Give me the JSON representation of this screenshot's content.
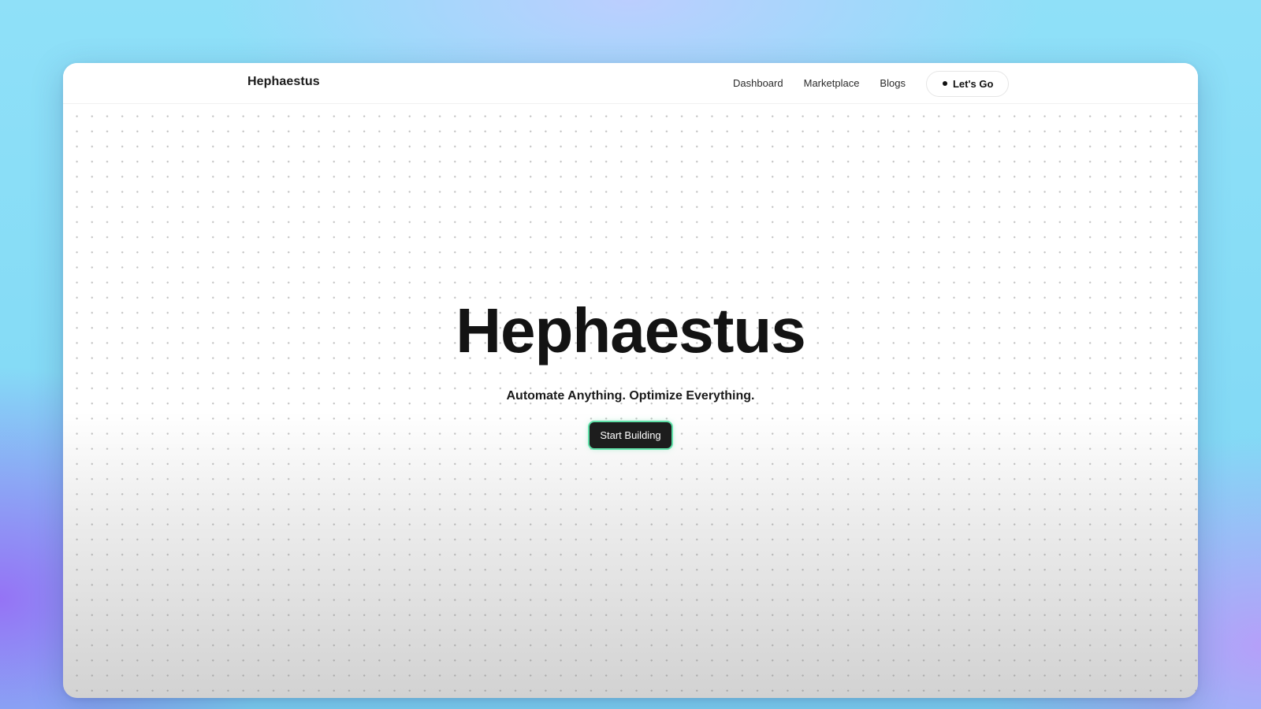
{
  "navbar": {
    "brand": "Hephaestus",
    "links": [
      "Dashboard",
      "Marketplace",
      "Blogs"
    ],
    "cta_label": "Let's Go"
  },
  "hero": {
    "title": "Hephaestus",
    "subtitle": "Automate Anything. Optimize Everything.",
    "button_label": "Start Building"
  },
  "colors": {
    "button_bg": "#1d1d1d",
    "button_glow": "#5fe0a8",
    "text": "#131313"
  }
}
